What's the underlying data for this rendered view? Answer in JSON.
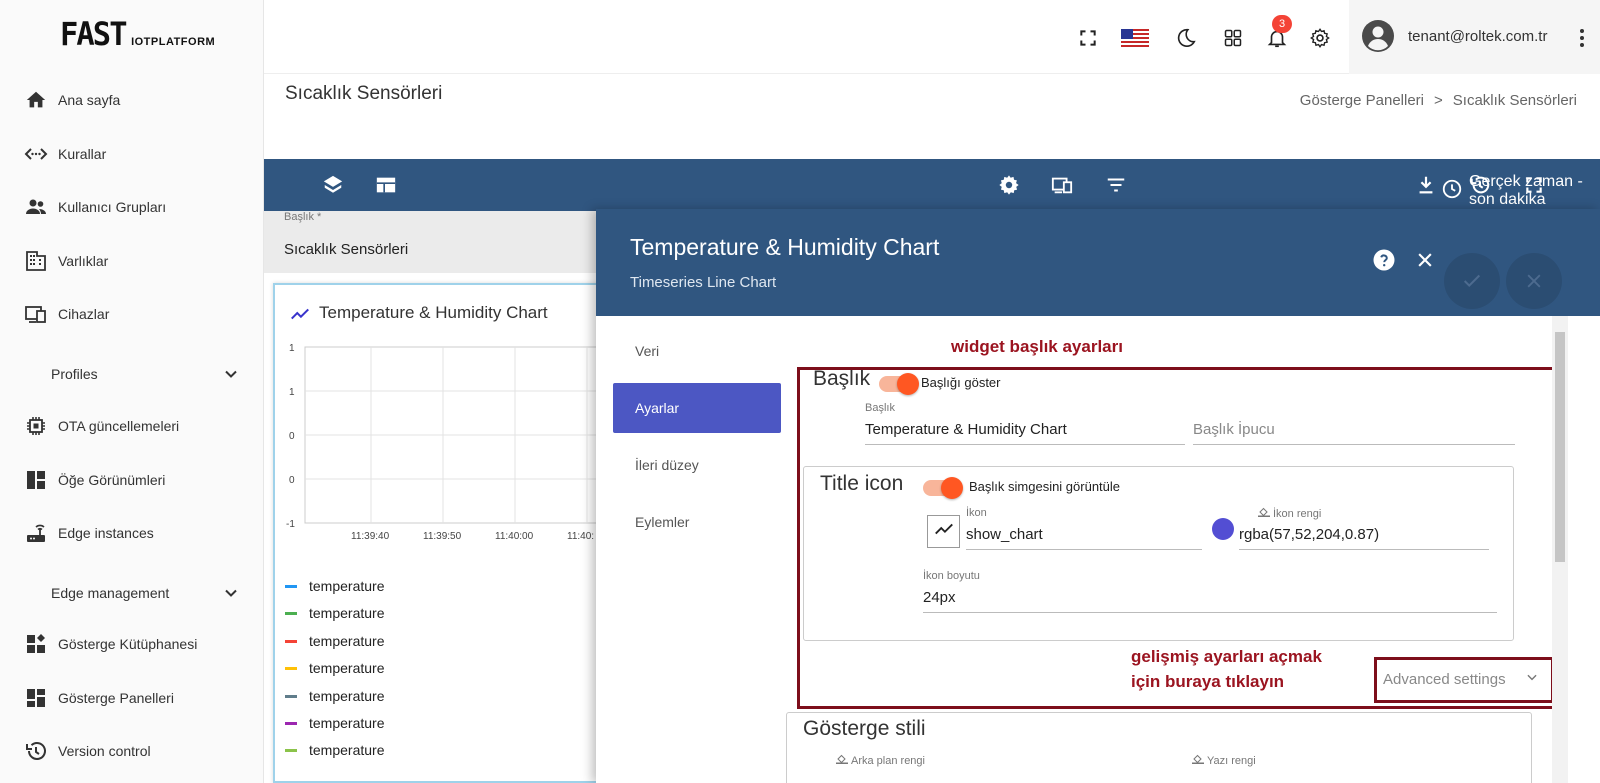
{
  "logo": {
    "main": "FAST",
    "sub": "IOTPLATFORM"
  },
  "sidebar": {
    "items": [
      {
        "label": "Ana sayfa"
      },
      {
        "label": "Kurallar"
      },
      {
        "label": "Kullanıcı Grupları"
      },
      {
        "label": "Varlıklar"
      },
      {
        "label": "Cihazlar"
      },
      {
        "label": "Profiles"
      },
      {
        "label": "OTA güncellemeleri"
      },
      {
        "label": "Öğe Görünümleri"
      },
      {
        "label": "Edge instances"
      },
      {
        "label": "Edge management"
      },
      {
        "label": "Gösterge Kütüphanesi"
      },
      {
        "label": "Gösterge Panelleri"
      },
      {
        "label": "Version control"
      }
    ]
  },
  "topbar": {
    "notification_count": "3",
    "user_email": "tenant@roltek.com.tr"
  },
  "header": {
    "title": "Sıcaklık Sensörleri",
    "breadcrumb": [
      "Gösterge Panelleri",
      ">",
      "Sıcaklık Sensörleri"
    ]
  },
  "dash_toolbar": {
    "realtime_label": "Gerçek zaman - son dakika"
  },
  "left_form": {
    "label": "Başlık *",
    "value": "Sıcaklık Sensörleri"
  },
  "widget": {
    "title": "Temperature & Humidity Chart",
    "y_ticks": [
      "1",
      "1",
      "0",
      "0",
      "-1"
    ],
    "x_ticks": [
      "11:39:40",
      "11:39:50",
      "11:40:00",
      "11:40:"
    ],
    "legend": [
      "temperature",
      "temperature",
      "temperature",
      "temperature",
      "temperature",
      "temperature",
      "temperature"
    ],
    "legend_colors": [
      "#2196f3",
      "#4caf50",
      "#f44336",
      "#ffc107",
      "#607d8b",
      "#9c27b0",
      "#8bc34a"
    ]
  },
  "panel": {
    "title": "Temperature & Humidity Chart",
    "subtitle": "Timeseries Line Chart",
    "tabs": [
      {
        "label": "Veri"
      },
      {
        "label": "Ayarlar"
      },
      {
        "label": "İleri düzey"
      },
      {
        "label": "Eylemler"
      }
    ],
    "annotation_top": "widget başlık ayarları",
    "annotation_bottom_1": "gelişmiş ayarları açmak",
    "annotation_bottom_2": "için buraya tıklayın",
    "title_section": {
      "legend": "Başlık",
      "toggle_label": "Başlığı göster",
      "title_label": "Başlık",
      "title_value": "Temperature & Humidity Chart",
      "tooltip_placeholder": "Başlık İpucu"
    },
    "icon_section": {
      "legend": "Title icon",
      "toggle_label": "Başlık simgesini görüntüle",
      "icon_label": "İkon",
      "icon_value": "show_chart",
      "color_label": "İkon rengi",
      "color_value": "rgba(57,52,204,0.87)",
      "size_label": "İkon boyutu",
      "size_value": "24px"
    },
    "advanced_label": "Advanced settings",
    "style_section": {
      "legend": "Gösterge stili",
      "bg_label": "Arka plan rengi",
      "text_label": "Yazı rengi"
    }
  }
}
